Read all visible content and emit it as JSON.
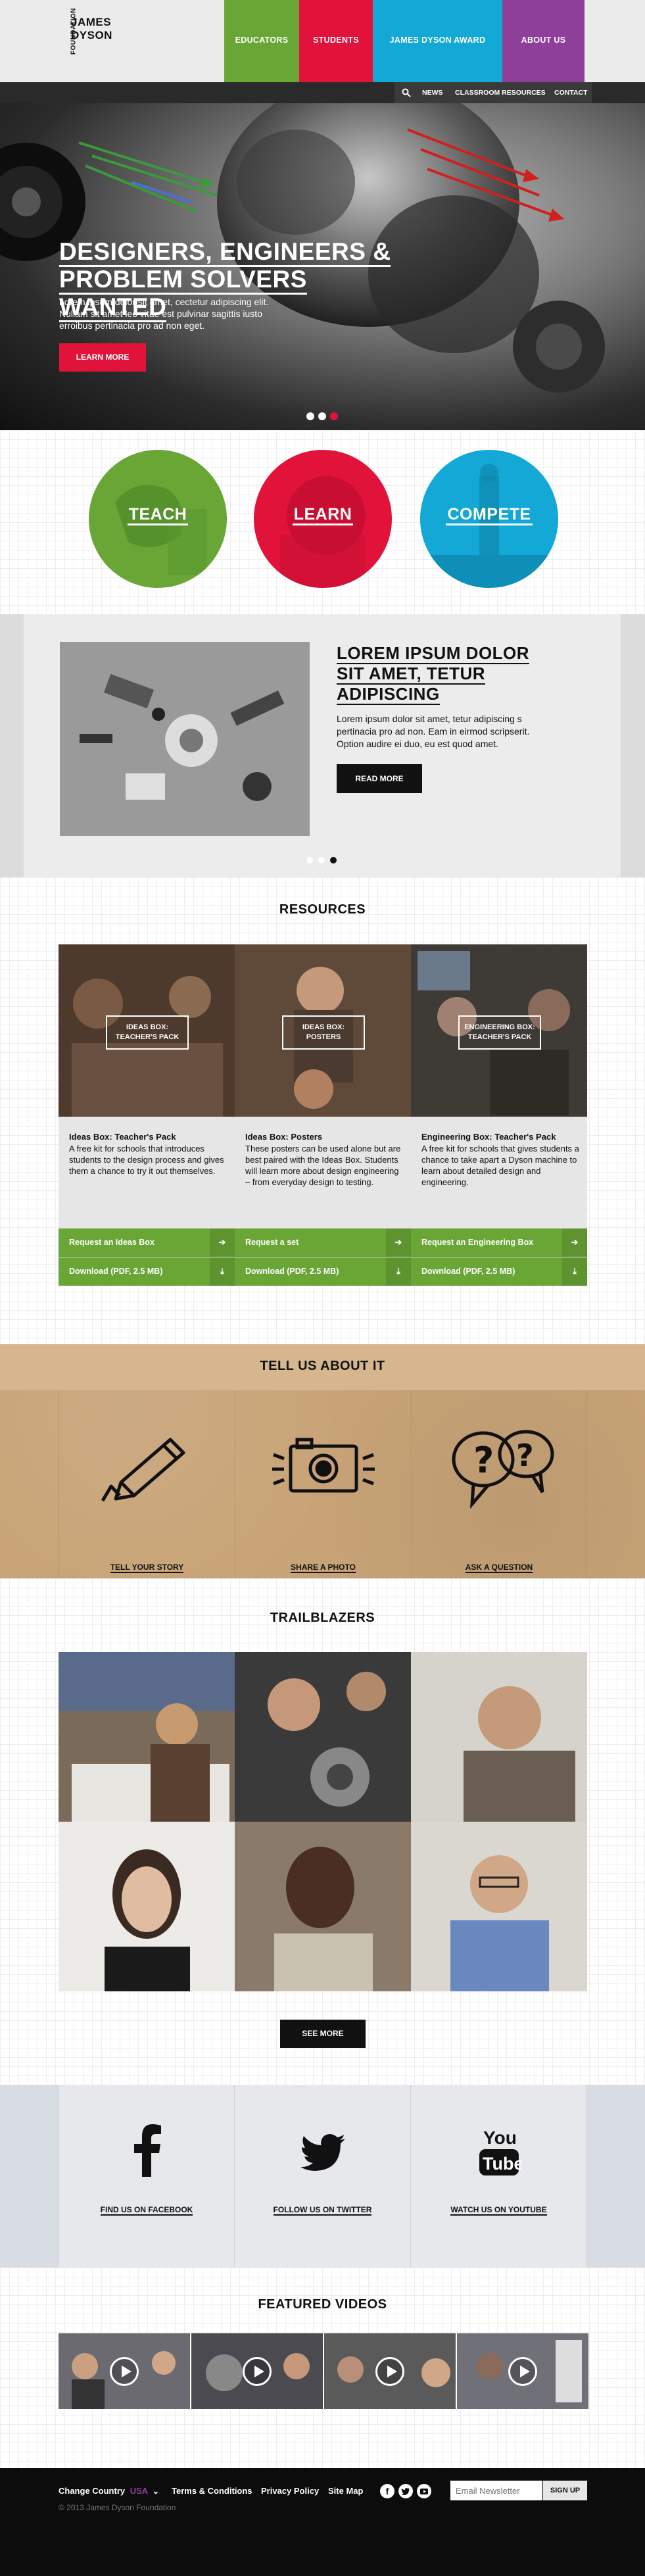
{
  "header": {
    "logo_vertical": "FOUNDATION",
    "logo_line1": "JAMES",
    "logo_line2": "DYSON",
    "nav": [
      {
        "label": "EDUCATORS",
        "color": "#6aa636"
      },
      {
        "label": "STUDENTS",
        "color": "#e2133a"
      },
      {
        "label": "JAMES DYSON AWARD",
        "color": "#13a8d6"
      },
      {
        "label": "ABOUT US",
        "color": "#8d3f99"
      }
    ],
    "subnav": [
      "NEWS",
      "CLASSROOM RESOURCES",
      "CONTACT"
    ],
    "search_icon": "search-icon"
  },
  "hero": {
    "title": [
      "DESIGNERS, ENGINEERS &",
      "PROBLEM SOLVERS WANTED"
    ],
    "text": "Lorem ipsum dolor sit amet, cectetur adipiscing elit. Nullam sit amet leo vitae est pulvinar sagittis iusto erroibus pertinacia pro ad non eget.",
    "button": "LEARN MORE"
  },
  "circles": [
    {
      "label": "TEACH",
      "color": "#6aa636"
    },
    {
      "label": "LEARN",
      "color": "#e2133a"
    },
    {
      "label": "COMPETE",
      "color": "#13a8d6"
    }
  ],
  "feature": {
    "title": [
      "LOREM IPSUM DOLOR",
      "SIT AMET, TETUR",
      "ADIPISCING"
    ],
    "text": "Lorem ipsum dolor sit amet, tetur adipiscing s pertinacia pro ad non. Eam in eirmod scripserit. Option audire ei duo, eu est quod amet.",
    "button": "READ MORE"
  },
  "resources": {
    "title": "RESOURCES",
    "items": [
      {
        "badge": [
          "IDEAS BOX:",
          "TEACHER'S PACK"
        ],
        "heading": "Ideas Box: Teacher's Pack",
        "desc": "A free kit for schools that introduces students to the design process and gives them a chance to try it out themselves.",
        "btn1": "Request an Ideas Box",
        "btn2": "Download (PDF, 2.5 MB)"
      },
      {
        "badge": [
          "IDEAS BOX:",
          "POSTERS"
        ],
        "heading": "Ideas Box: Posters",
        "desc": "These posters can be used alone but are best paired with the Ideas Box. Students will learn more about design engineering – from everyday design to testing.",
        "btn1": "Request a set",
        "btn2": "Download (PDF, 2.5 MB)"
      },
      {
        "badge": [
          "ENGINEERING BOX:",
          "TEACHER'S PACK"
        ],
        "heading": "Engineering Box: Teacher's Pack",
        "desc": "A free kit for schools that gives students a chance to take apart a Dyson machine to learn about detailed design and engineering.",
        "btn1": "Request an Engineering Box",
        "btn2": "Download (PDF, 2.5 MB)"
      }
    ]
  },
  "tell": {
    "title": "TELL US ABOUT IT",
    "items": [
      {
        "label": "TELL YOUR STORY",
        "icon": "pencil-icon"
      },
      {
        "label": "SHARE A PHOTO",
        "icon": "camera-icon"
      },
      {
        "label": "ASK A QUESTION",
        "icon": "question-bubbles-icon"
      }
    ]
  },
  "trailblazers": {
    "title": "TRAILBLAZERS",
    "button": "SEE MORE"
  },
  "social": [
    {
      "label": "FIND US ON FACEBOOK",
      "icon": "facebook-icon"
    },
    {
      "label": "FOLLOW US ON TWITTER",
      "icon": "twitter-icon"
    },
    {
      "label": "WATCH US ON YOUTUBE",
      "icon": "youtube-icon"
    }
  ],
  "videos": {
    "title": "FEATURED VIDEOS"
  },
  "footer": {
    "change_country": "Change Country",
    "country": "USA",
    "links": [
      "Terms & Conditions",
      "Privacy Policy",
      "Site Map"
    ],
    "newsletter_placeholder": "Email Newsletter",
    "signup": "SIGN UP",
    "copyright": "© 2013 James Dyson Foundation"
  }
}
